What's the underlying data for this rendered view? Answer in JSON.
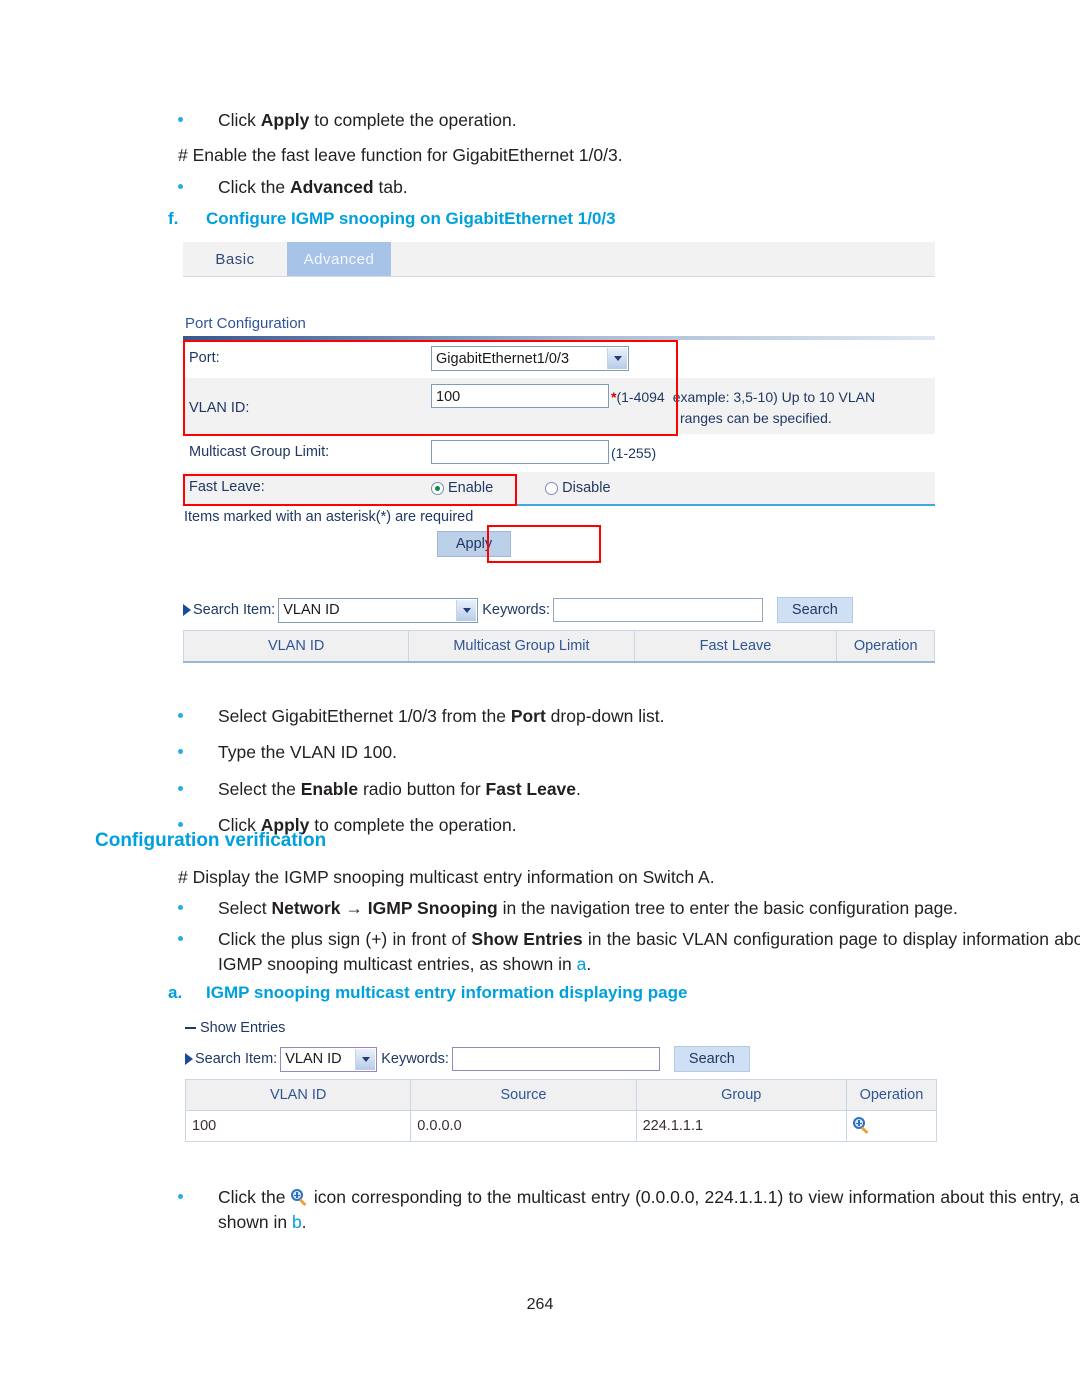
{
  "document": {
    "page_number": "264",
    "accent_blue": "#00a0dd",
    "annotation_red": "#ff0000"
  },
  "steps_top": {
    "bullet_1_pre": "Click ",
    "bullet_1_bold": "Apply",
    "bullet_1_post": " to complete the operation.",
    "comment_line": "# Enable the fast leave function for GigabitEthernet 1/0/3.",
    "bullet_2_pre": "Click the ",
    "bullet_2_bold": "Advanced",
    "bullet_2_post": " tab."
  },
  "figure_f": {
    "label": "f.",
    "caption": "Configure IGMP snooping on GigabitEthernet 1/0/3"
  },
  "ui_advanced": {
    "tabs": [
      {
        "label": "Basic",
        "selected": false
      },
      {
        "label": "Advanced",
        "selected": true
      }
    ],
    "panel_title": "Port Configuration",
    "fields": {
      "port_label": "Port:",
      "port_value": "GigabitEthernet1/0/3",
      "vlan_label": "VLAN ID:",
      "vlan_value": "100",
      "vlan_hint_star": "*",
      "vlan_hint_1": "(1-4094",
      "vlan_hint_2": "example: 3,5-10) Up to 10 VLAN",
      "vlan_hint_3": "ranges can be specified.",
      "mcast_label": "Multicast Group Limit:",
      "mcast_value": "",
      "mcast_hint": "(1-255)",
      "fastleave_label": "Fast Leave:",
      "fastleave_enable": "Enable",
      "fastleave_disable": "Disable",
      "fastleave_selected": "Enable"
    },
    "required_note": "Items marked with an asterisk(*) are required",
    "apply_label": "Apply",
    "search": {
      "search_item_label": "Search Item:",
      "search_item_value": "VLAN ID",
      "keywords_label": "Keywords:",
      "keywords_value": "",
      "search_button": "Search"
    },
    "table": {
      "columns": [
        "VLAN ID",
        "Multicast Group Limit",
        "Fast Leave",
        "Operation"
      ],
      "rows": []
    }
  },
  "steps_mid": {
    "b1_pre": "Select GigabitEthernet 1/0/3 from the ",
    "b1_bold": "Port",
    "b1_post": " drop-down list.",
    "b2": "Type the VLAN ID 100.",
    "b3_pre": "Select the ",
    "b3_bold1": "Enable",
    "b3_mid": " radio button for ",
    "b3_bold2": "Fast Leave",
    "b3_post": ".",
    "b4_pre": "Click ",
    "b4_bold": "Apply",
    "b4_post": " to complete the operation."
  },
  "section": {
    "configuration_verification": "Configuration verification",
    "display_line": "# Display the IGMP snooping multicast entry information on Switch A.",
    "sel_pre": "Select ",
    "sel_bold1": "Network",
    "sel_arrow": " → ",
    "sel_bold2": "IGMP Snooping",
    "sel_post": " in the navigation tree to enter the basic configuration page.",
    "plus_pre": "Click the plus sign (+) in front of ",
    "plus_bold": "Show Entries",
    "plus_mid": " in the basic VLAN configuration page to display information about IGMP snooping multicast entries, as shown in ",
    "plus_ref": "a",
    "plus_post": "."
  },
  "figure_a": {
    "label": "a.",
    "caption": "IGMP snooping multicast entry information displaying page"
  },
  "ui_entries": {
    "show_entries_label": "Show Entries",
    "search": {
      "search_item_label": "Search Item:",
      "search_item_value": "VLAN ID",
      "keywords_label": "Keywords:",
      "keywords_value": "",
      "search_button": "Search"
    },
    "table": {
      "columns": [
        "VLAN ID",
        "Source",
        "Group",
        "Operation"
      ],
      "rows": [
        {
          "vlan_id": "100",
          "source": "0.0.0.0",
          "group": "224.1.1.1",
          "operation_icon": "magnifier-plus-icon"
        }
      ]
    }
  },
  "steps_bottom": {
    "b_pre": "Click the ",
    "b_icon": "magnifier-plus-icon",
    "b_mid": " icon corresponding to the multicast entry (0.0.0.0, 224.1.1.1) to view information about this entry, as shown in ",
    "b_ref": "b",
    "b_post": "."
  }
}
